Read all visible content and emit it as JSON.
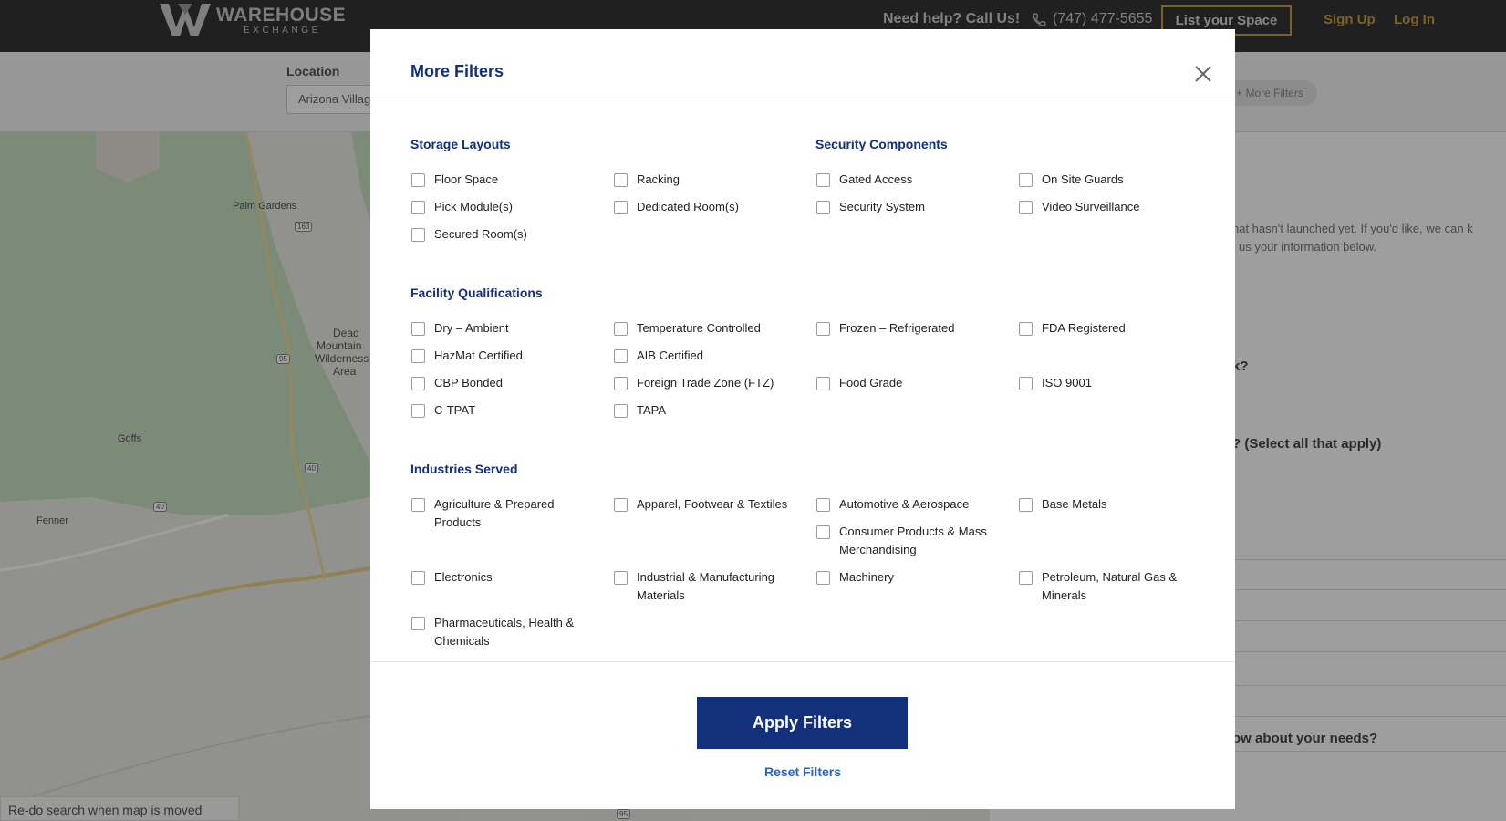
{
  "header": {
    "brand_line1": "WAREHOUSE",
    "brand_line2": "EXCHANGE",
    "help_text": "Need help? Call Us!",
    "phone": "(747) 477-5655",
    "list_space": "List your Space",
    "sign_up": "Sign Up",
    "log_in": "Log In"
  },
  "search": {
    "location_label": "Location",
    "location_value": "Arizona Villag",
    "more_filters_chip": "+ More Filters"
  },
  "map": {
    "labels": [
      "Palm Gardens",
      "Dead",
      "Mountain",
      "Wilderness",
      "Area",
      "Goffs",
      "Fenner"
    ],
    "shields": [
      "163",
      "95",
      "40",
      "40",
      "95"
    ],
    "redo_text": "Re-do search when map is moved"
  },
  "right_panel": {
    "text1": "hat hasn't launched yet. If you'd like, we can k",
    "text2": "us your information below.",
    "q1": "k?",
    "q2": "? (Select all that apply)",
    "q3": "ow about your needs?"
  },
  "modal": {
    "title": "More Filters",
    "sections": {
      "storage_layouts": {
        "title": "Storage Layouts",
        "items": [
          "Floor Space",
          "Racking",
          "Pick Module(s)",
          "Dedicated Room(s)",
          "Secured Room(s)"
        ]
      },
      "security_components": {
        "title": "Security Components",
        "items": [
          "Gated Access",
          "On Site Guards",
          "Security System",
          "Video Surveillance"
        ]
      },
      "facility_qualifications": {
        "title": "Facility Qualifications",
        "items": [
          "Dry – Ambient",
          "Temperature Controlled",
          "Frozen – Refrigerated",
          "FDA Registered",
          "HazMat Certified",
          "AIB Certified",
          "CBP Bonded",
          "Foreign Trade Zone (FTZ)",
          "Food Grade",
          "ISO 9001",
          "C-TPAT",
          "TAPA"
        ]
      },
      "industries_served": {
        "title": "Industries Served",
        "items": [
          "Agriculture & Prepared Products",
          "Apparel, Footwear & Textiles",
          "Automotive & Aerospace",
          "Base Metals",
          "Consumer Products & Mass Merchandising",
          "Electronics",
          "Industrial & Manufacturing Materials",
          "Machinery",
          "Petroleum, Natural Gas & Minerals",
          "Pharmaceuticals, Health & Chemicals"
        ]
      }
    },
    "apply_label": "Apply Filters",
    "reset_label": "Reset Filters"
  },
  "colors": {
    "navy": "#13307d",
    "gold": "#c8a03a",
    "link_blue": "#2b63c6",
    "header_bg": "#343434"
  }
}
